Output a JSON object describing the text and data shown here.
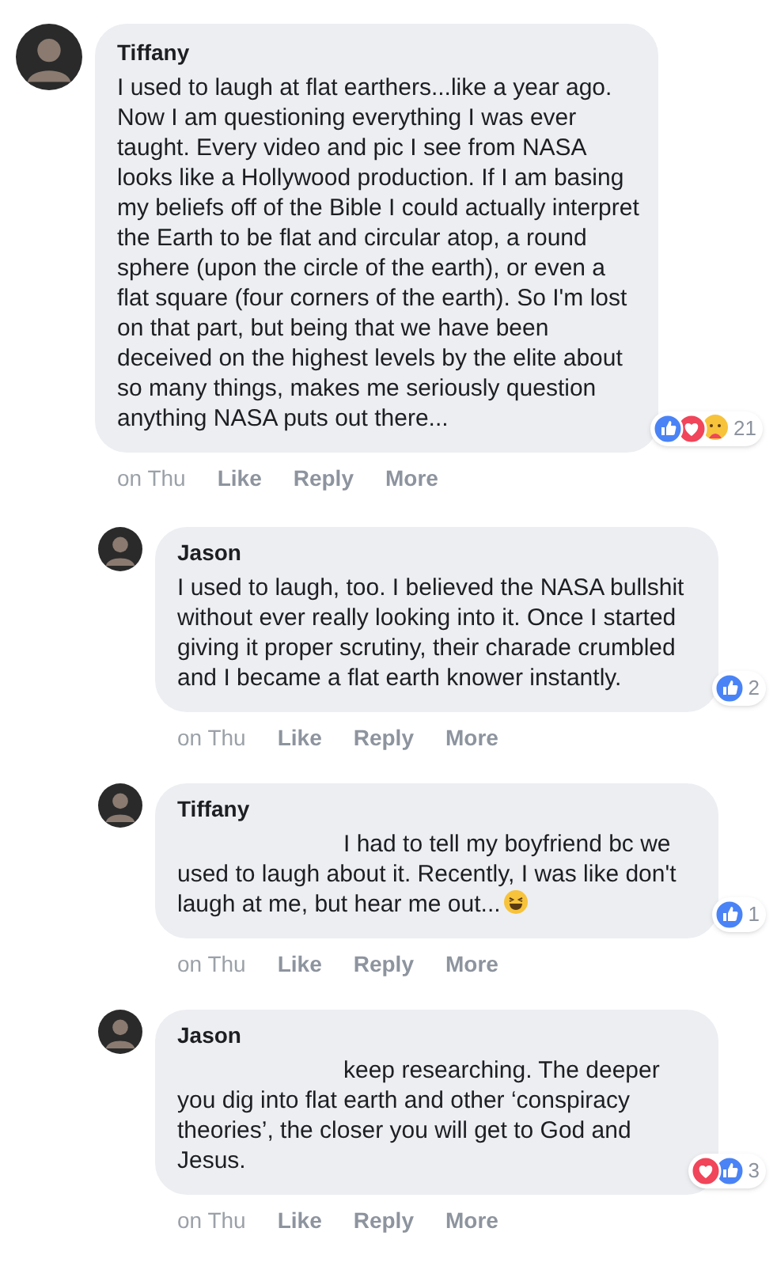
{
  "comments": [
    {
      "author": "Tiffany",
      "mention_hidden": false,
      "text": "I used to laugh at flat earthers...like a year ago. Now I am questioning everything I was ever taught. Every video and pic I see from NASA looks like a Hollywood production. If I am basing my beliefs off of the Bible I could actually interpret the Earth to be flat and circular atop, a round sphere (upon the circle of the earth), or even a flat square (four corners of the earth). So I'm lost on that part, but being that we have been deceived on the highest levels by the elite about so many things, makes me seriously question anything NASA puts out there...",
      "emoji": false,
      "reactions": [
        {
          "kind": "like"
        },
        {
          "kind": "love"
        },
        {
          "kind": "care"
        }
      ],
      "reaction_count": "21",
      "time": "on Thu",
      "actions": [
        "Like",
        "Reply",
        "More"
      ],
      "children": [
        {
          "author": "Jason",
          "mention_hidden": false,
          "text": "I used to laugh, too. I believed the NASA bullshit without ever really looking into it. Once I started giving it proper scrutiny, their charade crumbled and I became a flat earth knower instantly.",
          "emoji": false,
          "reactions": [
            {
              "kind": "like"
            }
          ],
          "reaction_count": "2",
          "time": "on Thu",
          "actions": [
            "Like",
            "Reply",
            "More"
          ]
        },
        {
          "author": "Tiffany",
          "mention_hidden": true,
          "text": "I had to tell my boyfriend bc we used to laugh about it. Recently, I was like don't laugh at me, but hear me out...",
          "emoji": true,
          "reactions": [
            {
              "kind": "like"
            }
          ],
          "reaction_count": "1",
          "time": "on Thu",
          "actions": [
            "Like",
            "Reply",
            "More"
          ]
        },
        {
          "author": "Jason",
          "mention_hidden": true,
          "text": "keep researching. The deeper you dig into flat earth and other ‘conspiracy theories’, the closer you will get to God and Jesus.",
          "emoji": false,
          "reactions": [
            {
              "kind": "love"
            },
            {
              "kind": "like"
            }
          ],
          "reaction_count": "3",
          "time": "on Thu",
          "actions": [
            "Like",
            "Reply",
            "More"
          ]
        }
      ]
    }
  ]
}
